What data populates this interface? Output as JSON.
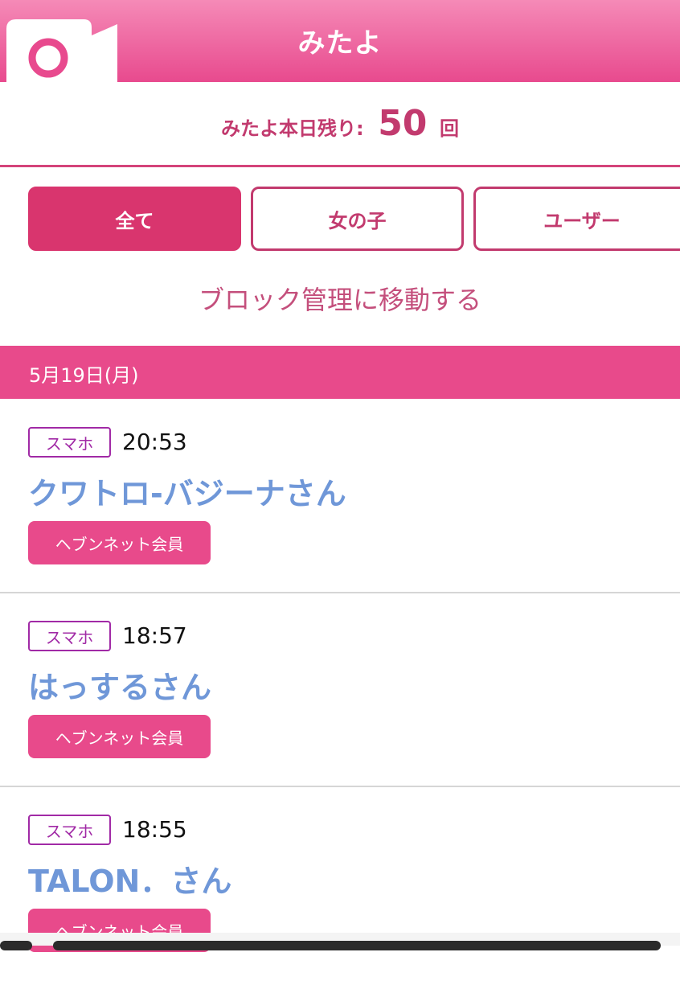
{
  "header": {
    "title": "みたよ",
    "logo_icon": "camera-icon"
  },
  "remaining": {
    "label": "みたよ本日残り:",
    "count": "50",
    "unit": "回"
  },
  "filters": [
    {
      "label": "全て",
      "active": true
    },
    {
      "label": "女の子",
      "active": false
    },
    {
      "label": "ユーザー",
      "active": false
    }
  ],
  "block_link": "ブロック管理に移動する",
  "date_header": "5月19日(月)",
  "entries": [
    {
      "device": "スマホ",
      "time": "20:53",
      "name": "クワトロ-バジーナさん",
      "badge": "ヘブンネット会員"
    },
    {
      "device": "スマホ",
      "time": "18:57",
      "name": "はっするさん",
      "badge": "ヘブンネット会員"
    },
    {
      "device": "スマホ",
      "time": "18:55",
      "name": "TALON．さん",
      "badge": "ヘブンネット会員"
    }
  ],
  "colors": {
    "brand_pink": "#e84a8b",
    "active_button": "#d9356e",
    "name_blue": "#6f97d8",
    "device_purple": "#a12aa6"
  }
}
